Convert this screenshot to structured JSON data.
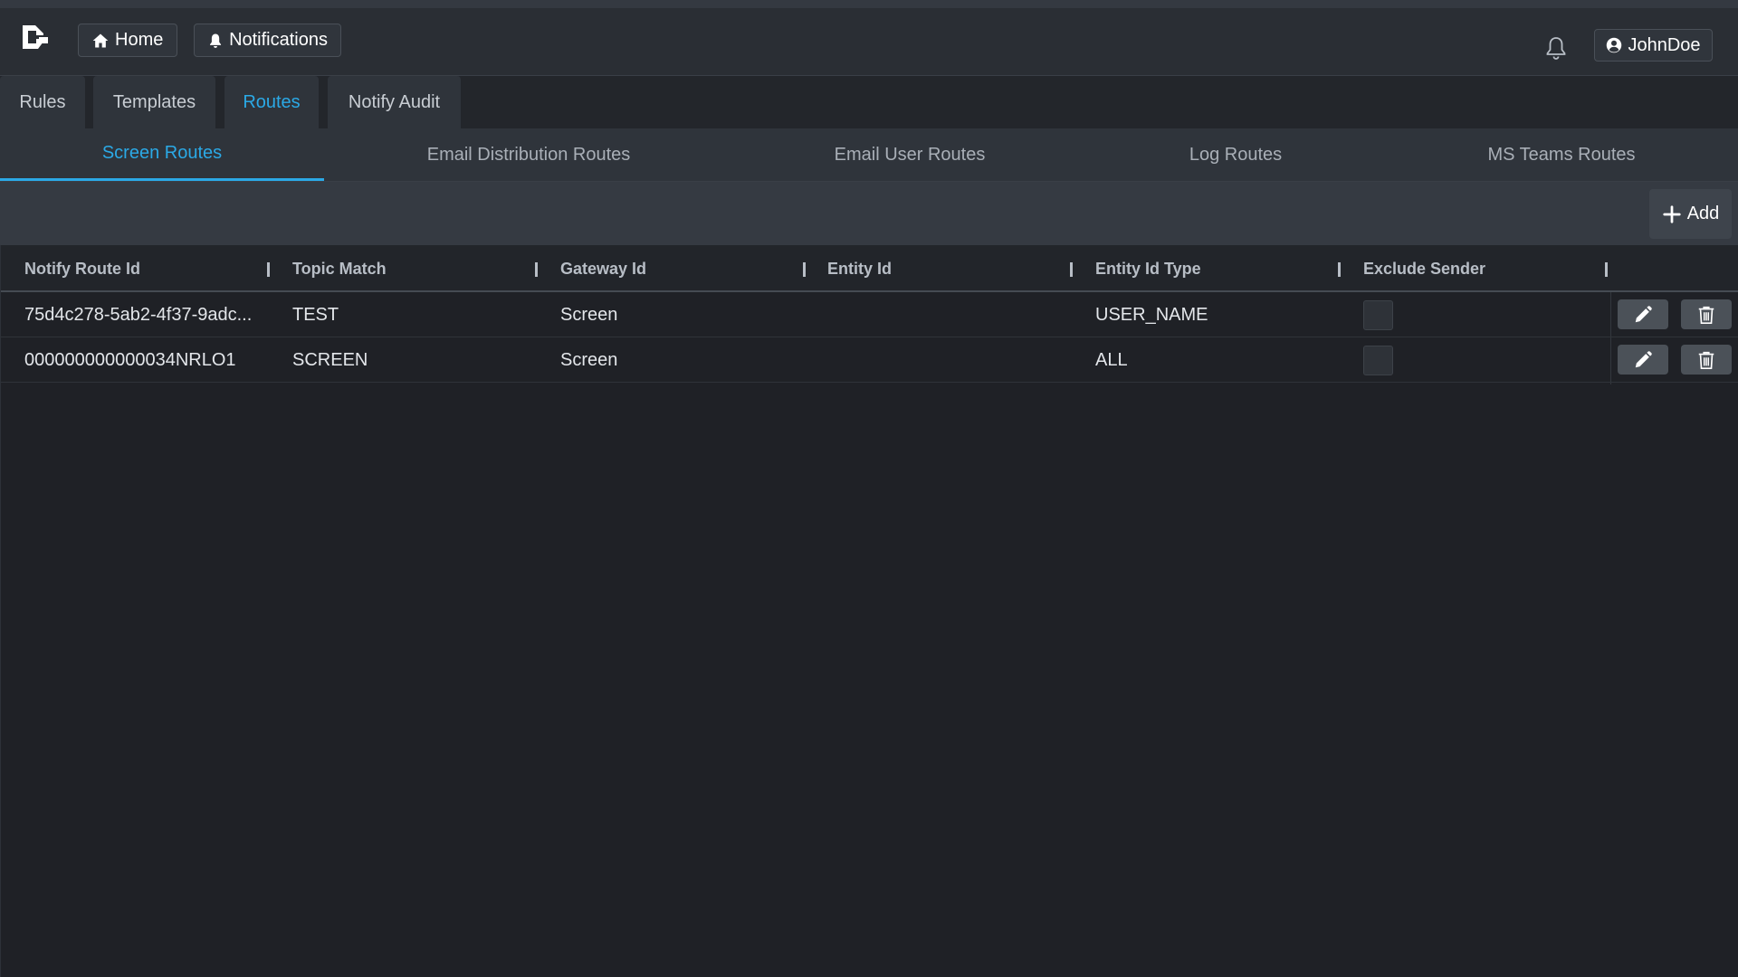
{
  "header": {
    "home_label": "Home",
    "notifications_label": "Notifications",
    "user_name": "JohnDoe"
  },
  "main_tabs": [
    {
      "label": "Rules",
      "active": false
    },
    {
      "label": "Templates",
      "active": false
    },
    {
      "label": "Routes",
      "active": true
    },
    {
      "label": "Notify Audit",
      "active": false
    }
  ],
  "sub_tabs": [
    {
      "label": "Screen Routes",
      "active": true
    },
    {
      "label": "Email Distribution Routes",
      "active": false
    },
    {
      "label": "Email User Routes",
      "active": false
    },
    {
      "label": "Log Routes",
      "active": false
    },
    {
      "label": "MS Teams Routes",
      "active": false
    }
  ],
  "toolbar": {
    "add_label": "Add"
  },
  "table": {
    "columns": [
      "Notify Route Id",
      "Topic Match",
      "Gateway Id",
      "Entity Id",
      "Entity Id Type",
      "Exclude Sender"
    ],
    "rows": [
      {
        "route_id": "75d4c278-5ab2-4f37-9adc...",
        "topic_match": "TEST",
        "gateway_id": "Screen",
        "entity_id": "",
        "entity_id_type": "USER_NAME",
        "exclude_sender": false
      },
      {
        "route_id": "000000000000034NRLO1",
        "topic_match": "SCREEN",
        "gateway_id": "Screen",
        "entity_id": "",
        "entity_id_type": "ALL",
        "exclude_sender": false
      }
    ]
  },
  "colors": {
    "accent": "#2ba9e6",
    "background": "#1f2126",
    "topbar": "#2a2e34",
    "tab_bg": "#2f343b",
    "toolbar_bg": "#353a42"
  },
  "icons": {
    "logo": "app-logo-icon",
    "home": "home-icon",
    "notifications": "bell-icon",
    "user": "user-circle-icon",
    "add": "plus-icon",
    "edit": "pencil-icon",
    "delete": "trash-icon"
  }
}
